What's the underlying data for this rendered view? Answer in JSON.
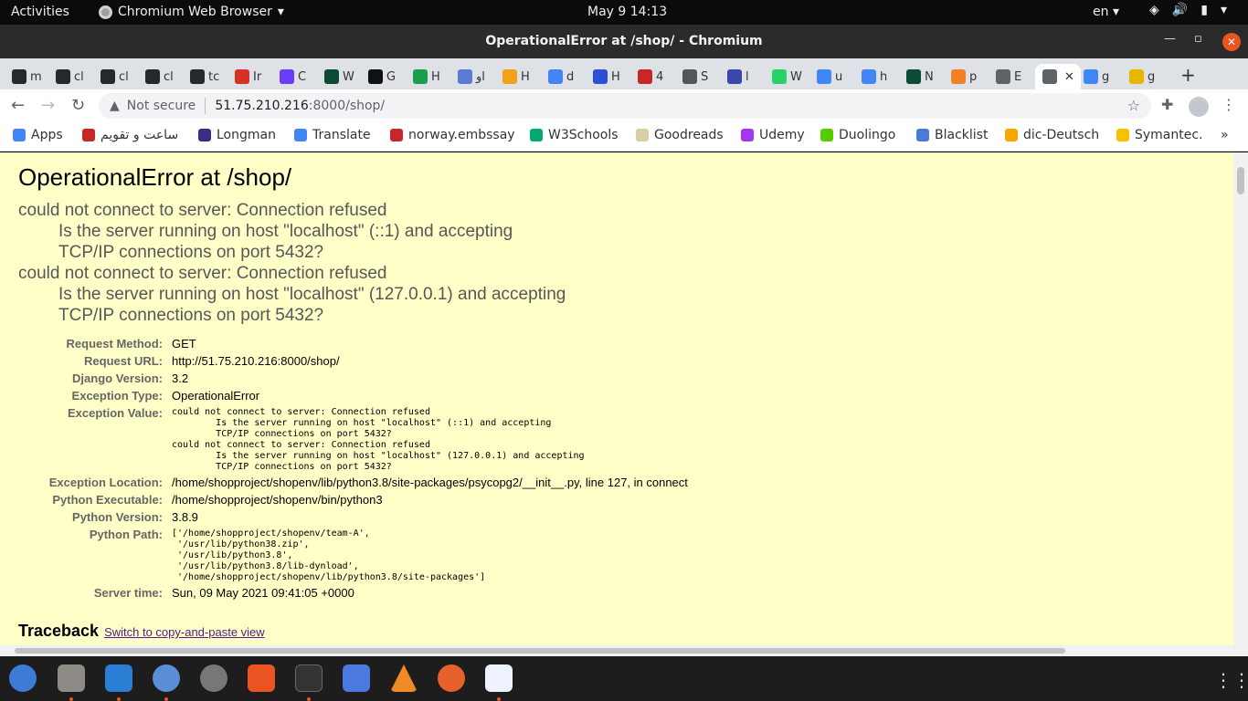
{
  "topbar": {
    "activities": "Activities",
    "app_name": "Chromium Web Browser",
    "clock": "May 9  14:13",
    "lang": "en"
  },
  "window": {
    "title": "OperationalError at /shop/ - Chromium"
  },
  "tabs": [
    {
      "icon": "github-icon",
      "label": "m"
    },
    {
      "icon": "github-icon",
      "label": "cl"
    },
    {
      "icon": "github-icon",
      "label": "cl"
    },
    {
      "icon": "github-icon",
      "label": "cl"
    },
    {
      "icon": "github-icon",
      "label": "tc"
    },
    {
      "icon": "gmail-icon",
      "label": "Ir"
    },
    {
      "icon": "diamond-icon",
      "label": "C"
    },
    {
      "icon": "django-icon",
      "label": "W"
    },
    {
      "icon": "tab-icon",
      "label": "G"
    },
    {
      "icon": "w-icon",
      "label": "H"
    },
    {
      "icon": "book-icon",
      "label": "او"
    },
    {
      "icon": "orange-icon",
      "label": "H"
    },
    {
      "icon": "google-icon",
      "label": "d"
    },
    {
      "icon": "fan-icon",
      "label": "H"
    },
    {
      "icon": "red-icon",
      "label": "4"
    },
    {
      "icon": "grid-icon",
      "label": "S"
    },
    {
      "icon": "bar-icon",
      "label": "ا"
    },
    {
      "icon": "whatsapp-icon",
      "label": "W"
    },
    {
      "icon": "google-icon",
      "label": "u"
    },
    {
      "icon": "google-icon",
      "label": "h"
    },
    {
      "icon": "django-icon",
      "label": "N"
    },
    {
      "icon": "stack-icon",
      "label": "p"
    },
    {
      "icon": "globe-icon",
      "label": "E"
    },
    {
      "icon": "globe-icon",
      "label": ""
    },
    {
      "icon": "google-icon",
      "label": "g"
    },
    {
      "icon": "flag-icon",
      "label": "g"
    }
  ],
  "omnibox": {
    "security": "Not secure",
    "host": "51.75.210.216",
    "path": ":8000/shop/"
  },
  "bookmarks": [
    {
      "icon": "apps-icon",
      "label": "Apps"
    },
    {
      "icon": "check-icon",
      "label": "ساعت و تقویم"
    },
    {
      "icon": "longman-icon",
      "label": "Longman"
    },
    {
      "icon": "translate-icon",
      "label": "Translate"
    },
    {
      "icon": "udi-icon",
      "label": "norway.embssay"
    },
    {
      "icon": "w3-icon",
      "label": "W3Schools"
    },
    {
      "icon": "goodreads-icon",
      "label": "Goodreads"
    },
    {
      "icon": "udemy-icon",
      "label": "Udemy"
    },
    {
      "icon": "duolingo-icon",
      "label": "Duolingo"
    },
    {
      "icon": "globe-icon",
      "label": "Blacklist"
    },
    {
      "icon": "dic-icon",
      "label": "dic-Deutsch"
    },
    {
      "icon": "symantec-icon",
      "label": "Symantec."
    }
  ],
  "page": {
    "heading": "OperationalError at /shop/",
    "message_lines": [
      "could not connect to server: Connection refused",
      "\tIs the server running on host \"localhost\" (::1) and accepting",
      "\tTCP/IP connections on port 5432?",
      "could not connect to server: Connection refused",
      "\tIs the server running on host \"localhost\" (127.0.0.1) and accepting",
      "\tTCP/IP connections on port 5432?"
    ],
    "meta": {
      "request_method_label": "Request Method:",
      "request_method": "GET",
      "request_url_label": "Request URL:",
      "request_url": "http://51.75.210.216:8000/shop/",
      "django_version_label": "Django Version:",
      "django_version": "3.2",
      "exception_type_label": "Exception Type:",
      "exception_type": "OperationalError",
      "exception_value_label": "Exception Value:",
      "exception_value": "could not connect to server: Connection refused\n\tIs the server running on host \"localhost\" (::1) and accepting\n\tTCP/IP connections on port 5432?\ncould not connect to server: Connection refused\n\tIs the server running on host \"localhost\" (127.0.0.1) and accepting\n\tTCP/IP connections on port 5432?",
      "exception_location_label": "Exception Location:",
      "exception_location": "/home/shopproject/shopenv/lib/python3.8/site-packages/psycopg2/__init__.py, line 127, in connect",
      "python_executable_label": "Python Executable:",
      "python_executable": "/home/shopproject/shopenv/bin/python3",
      "python_version_label": "Python Version:",
      "python_version": "3.8.9",
      "python_path_label": "Python Path:",
      "python_path": "['/home/shopproject/shopenv/team-A',\n '/usr/lib/python38.zip',\n '/usr/lib/python3.8',\n '/usr/lib/python3.8/lib-dynload',\n '/home/shopproject/shopenv/lib/python3.8/site-packages']",
      "server_time_label": "Server time:",
      "server_time": "Sun, 09 May 2021 09:41:05 +0000"
    },
    "traceback_title": "Traceback",
    "traceback_link": "Switch to copy-and-paste view"
  },
  "colors": {
    "page_bg": "#ffffc8",
    "accent": "#e95420"
  }
}
